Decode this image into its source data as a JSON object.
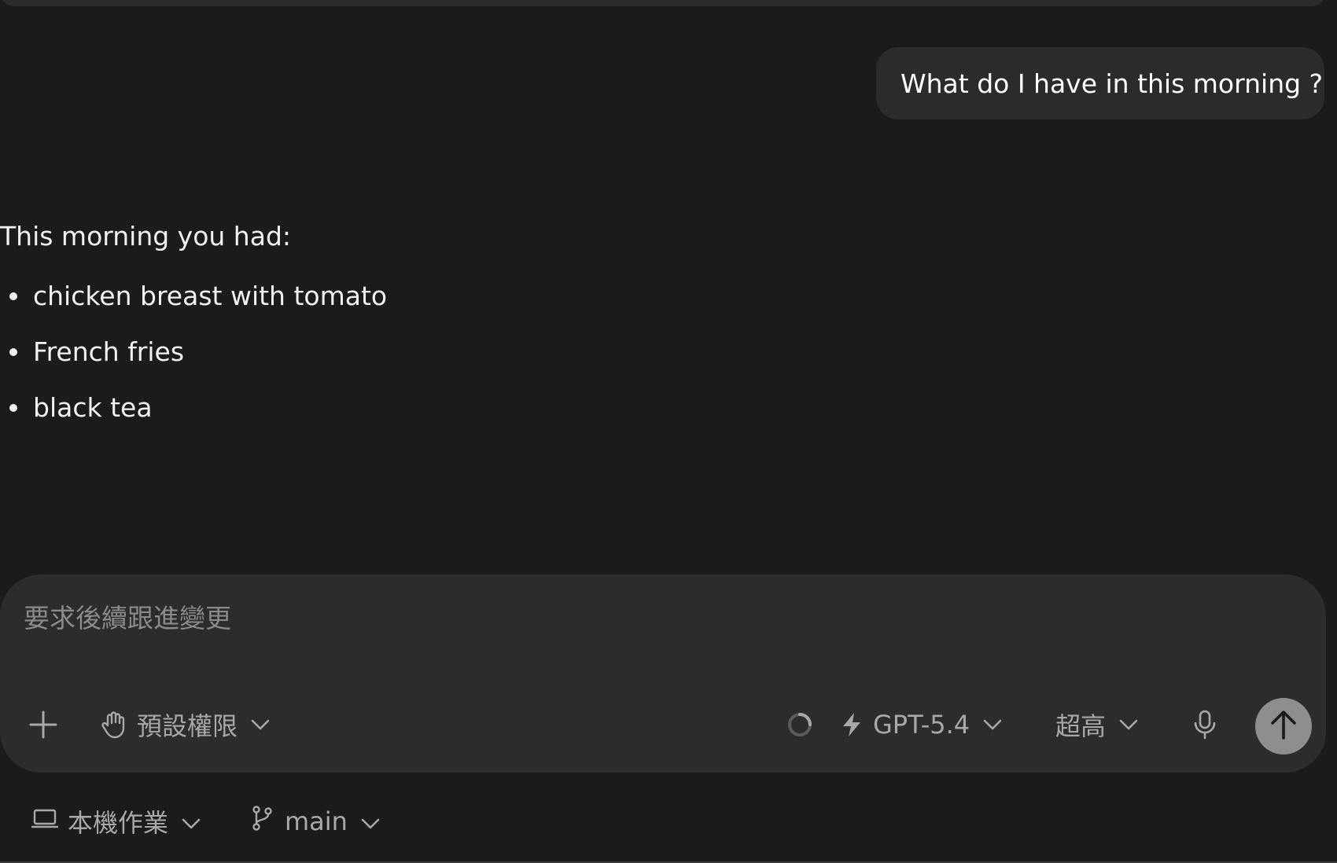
{
  "conversation": {
    "user_message": "What do I have in this morning ?",
    "assistant_intro": "This morning you had:",
    "assistant_items": [
      "chicken breast with tomato",
      "French fries",
      "black tea"
    ]
  },
  "composer": {
    "placeholder": "要求後續跟進變更",
    "add_icon": "plus-icon",
    "permissions": {
      "icon": "hand-icon",
      "label": "預設權限"
    },
    "status_icon": "loading-spinner-icon",
    "model": {
      "icon": "lightning-icon",
      "label": "GPT-5.4"
    },
    "effort": {
      "label": "超高"
    },
    "mic_icon": "microphone-icon",
    "send_icon": "arrow-up-icon"
  },
  "footer": {
    "environment": {
      "icon": "laptop-icon",
      "label": "本機作業"
    },
    "branch": {
      "icon": "git-branch-icon",
      "label": "main"
    }
  },
  "colors": {
    "background": "#1b1b1b",
    "bubble": "#2b2b2b",
    "composer": "#2c2c2c",
    "text": "#f1f1f1",
    "muted": "#a8a8a8",
    "send_button": "#8e8e8e"
  }
}
